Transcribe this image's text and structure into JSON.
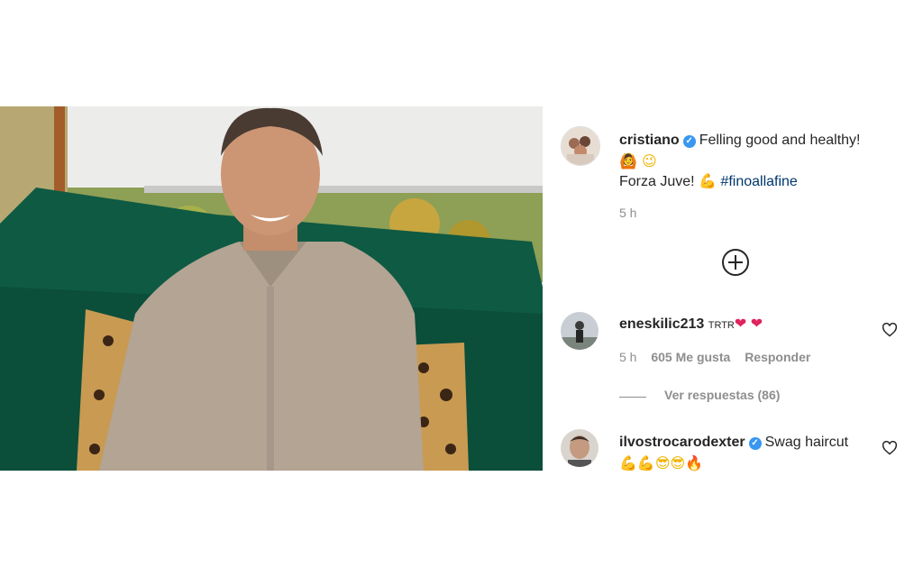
{
  "post": {
    "author": "cristiano",
    "caption_line1": "Felling good and healthy!",
    "caption_line2_prefix": "Forza Juve!",
    "hashtag": "#finoallafine",
    "time": "5 h"
  },
  "comments": [
    {
      "username": "eneskilic213",
      "text": "TRTR",
      "time": "5 h",
      "likes": "605 Me gusta",
      "reply": "Responder",
      "view_replies": "Ver respuestas (86)"
    },
    {
      "username": "ilvostrocarodexter",
      "text": "Swag haircut"
    }
  ],
  "icons": {
    "verified": "verified-badge",
    "more": "add-circle-icon",
    "like": "heart-outline-icon"
  },
  "colors": {
    "link": "#00376b",
    "verified": "#3897f0",
    "muted": "#8e8e8e"
  }
}
